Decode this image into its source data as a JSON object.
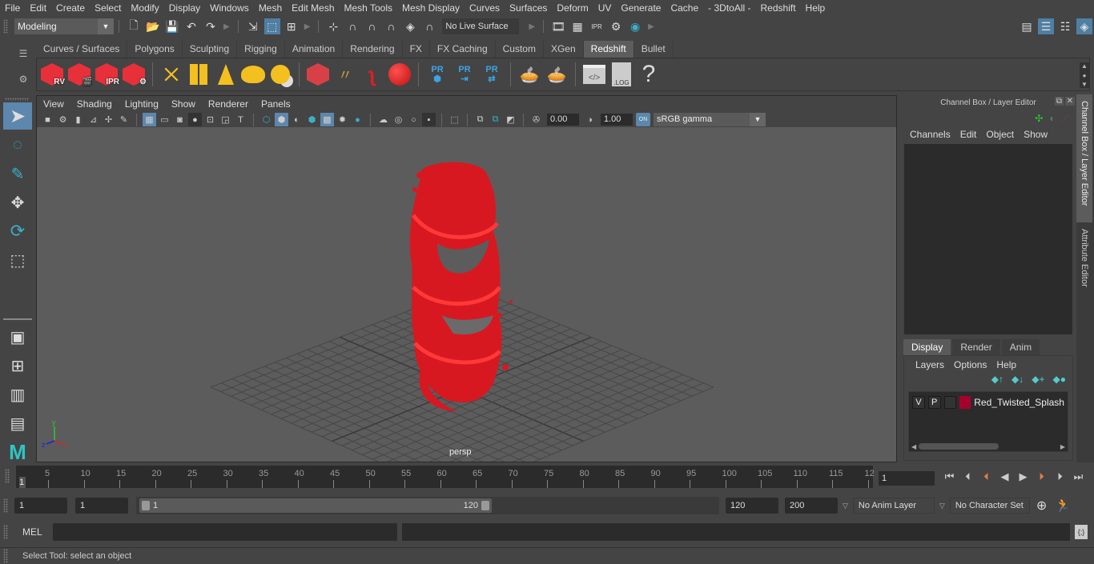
{
  "menubar": [
    "File",
    "Edit",
    "Create",
    "Select",
    "Modify",
    "Display",
    "Windows",
    "Mesh",
    "Edit Mesh",
    "Mesh Tools",
    "Mesh Display",
    "Curves",
    "Surfaces",
    "Deform",
    "UV",
    "Generate",
    "Cache",
    "- 3DtoAll -",
    "Redshift",
    "Help"
  ],
  "statusline": {
    "mode": "Modeling",
    "live_surface": "No Live Surface"
  },
  "shelf": {
    "tabs": [
      "Curves / Surfaces",
      "Polygons",
      "Sculpting",
      "Rigging",
      "Animation",
      "Rendering",
      "FX",
      "FX Caching",
      "Custom",
      "XGen",
      "Redshift",
      "Bullet"
    ],
    "active_tab": "Redshift",
    "icons": [
      {
        "name": "rv",
        "label": "RV"
      },
      {
        "name": "render-sequence",
        "label": ""
      },
      {
        "name": "ipr",
        "label": "IPR"
      },
      {
        "name": "render-settings",
        "label": ""
      },
      {
        "name": "area-light",
        "label": ""
      },
      {
        "name": "portal-light",
        "label": ""
      },
      {
        "name": "spot-light",
        "label": ""
      },
      {
        "name": "dome-light",
        "label": ""
      },
      {
        "name": "sun-sky",
        "label": ""
      },
      {
        "name": "volume",
        "label": ""
      },
      {
        "name": "hair",
        "label": ""
      },
      {
        "name": "mesh-light",
        "label": ""
      },
      {
        "name": "sphere-material",
        "label": ""
      },
      {
        "name": "pr-1",
        "label": "PR"
      },
      {
        "name": "pr-2",
        "label": "PR"
      },
      {
        "name": "pr-3",
        "label": "PR"
      },
      {
        "name": "bake-1",
        "label": ""
      },
      {
        "name": "bake-2",
        "label": ""
      },
      {
        "name": "script",
        "label": ""
      },
      {
        "name": "log",
        "label": ".LOG"
      },
      {
        "name": "help",
        "label": "?"
      }
    ]
  },
  "viewport": {
    "menu": [
      "View",
      "Shading",
      "Lighting",
      "Show",
      "Renderer",
      "Panels"
    ],
    "exposure": "0.00",
    "gamma": "1.00",
    "color_space": "sRGB gamma",
    "camera": "persp",
    "on_label": "ON"
  },
  "channel_box": {
    "title": "Channel Box / Layer Editor",
    "menu": [
      "Channels",
      "Edit",
      "Object",
      "Show"
    ]
  },
  "layer_editor": {
    "tabs": [
      "Display",
      "Render",
      "Anim"
    ],
    "active_tab": "Display",
    "menu": [
      "Layers",
      "Options",
      "Help"
    ],
    "layers": [
      {
        "v": "V",
        "p": "P",
        "color": "#a8002c",
        "name": "Red_Twisted_Splash"
      }
    ]
  },
  "side_tabs": [
    "Channel Box / Layer Editor",
    "Attribute Editor"
  ],
  "timeline": {
    "ticks": [
      "5",
      "10",
      "15",
      "20",
      "25",
      "30",
      "35",
      "40",
      "45",
      "50",
      "55",
      "60",
      "65",
      "70",
      "75",
      "80",
      "85",
      "90",
      "95",
      "100",
      "105",
      "110",
      "115",
      "12"
    ],
    "current_frame_marker": "1",
    "current_frame": "1"
  },
  "range": {
    "start": "1",
    "playback_start": "1",
    "range_start": "1",
    "range_end": "120",
    "playback_end": "120",
    "end": "200",
    "anim_layer": "No Anim Layer",
    "character_set": "No Character Set"
  },
  "command_line": {
    "language": "MEL",
    "input": "",
    "output": ""
  },
  "status": "Select Tool: select an object",
  "colors": {
    "accent": "#5d87ac",
    "redshift_red": "#e8303a",
    "object_red": "#d81820"
  }
}
